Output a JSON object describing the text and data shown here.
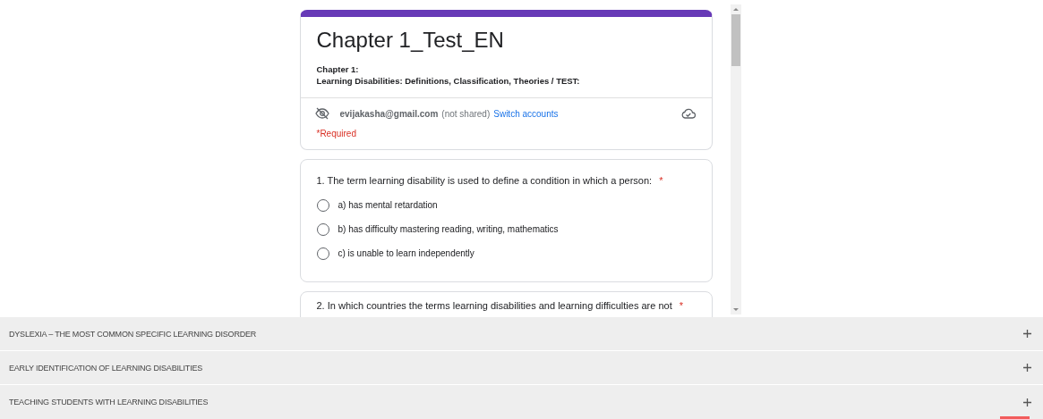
{
  "form": {
    "title": "Chapter 1_Test_EN",
    "description_lines": [
      "Chapter 1:",
      "Learning Disabilities: Definitions, Classification, Theories / TEST:"
    ],
    "account": {
      "email": "evijakasha@gmail.com",
      "sharing": "(not shared)",
      "switch_link": "Switch accounts"
    },
    "required_note": "*Required",
    "questions": [
      {
        "text": "1. The term learning disability is used to define a condition in which a person:",
        "required_mark": "*",
        "options": [
          {
            "label": "a) has mental retardation",
            "selected": false
          },
          {
            "label": "b) has difficulty mastering reading, writing, mathematics",
            "selected": false
          },
          {
            "label": "c) is unable to learn independently",
            "selected": false
          }
        ]
      },
      {
        "text": "2. In which countries the terms learning disabilities and learning difficulties are not",
        "required_mark": "*"
      }
    ]
  },
  "sections": [
    {
      "title": "DYSLEXIA – THE MOST COMMON SPECIFIC LEARNING DISORDER",
      "expanded": false
    },
    {
      "title": "EARLY IDENTIFICATION OF LEARNING DISABILITIES",
      "expanded": false
    },
    {
      "title": "TEACHING STUDENTS WITH LEARNING DISABILITIES",
      "expanded": false
    }
  ]
}
